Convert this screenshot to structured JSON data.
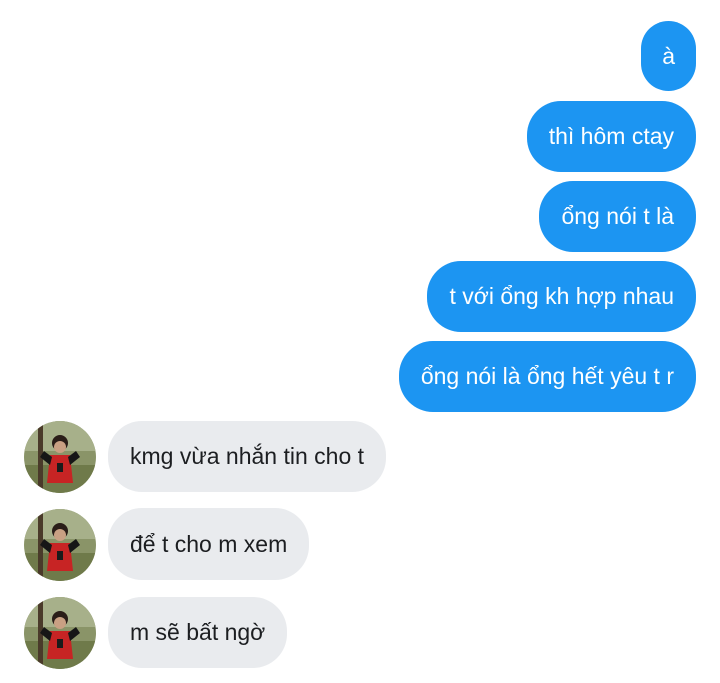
{
  "conversation": {
    "sent_messages": [
      {
        "text": "à"
      },
      {
        "text": "thì hôm ctay"
      },
      {
        "text": "ổng nói t là"
      },
      {
        "text": "t với ổng kh hợp nhau"
      },
      {
        "text": "ổng nói là ổng hết yêu t r"
      }
    ],
    "received_messages": [
      {
        "text": "kmg vừa nhắn tin cho t"
      },
      {
        "text": "để t cho m xem"
      },
      {
        "text": "m sẽ bất ngờ"
      }
    ]
  },
  "colors": {
    "sent_bubble": "#1c95f2",
    "received_bubble": "#e9ebee",
    "background": "#ffffff"
  }
}
